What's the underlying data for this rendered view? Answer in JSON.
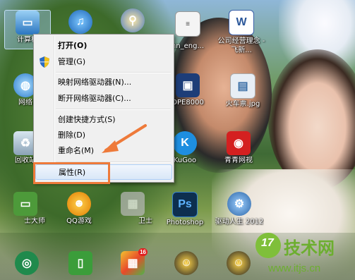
{
  "desktop_icons": [
    {
      "label": "计算机",
      "icon": "computer-icon",
      "selected": true
    },
    {
      "label": "",
      "icon": "itunes-icon"
    },
    {
      "label": "",
      "icon": "search-globe-icon"
    },
    {
      "label": "hn_eng...",
      "icon": "document-icon"
    },
    {
      "label": "公司经营理念 - 飞新...",
      "icon": "word-document-icon"
    },
    {
      "label": "网络",
      "icon": "network-icon"
    },
    {
      "label": "OPE8000",
      "icon": "application-icon"
    },
    {
      "label": "火车票.jpg",
      "icon": "image-file-icon"
    },
    {
      "label": "回收站",
      "icon": "recycle-bin-icon"
    },
    {
      "label": "KuGoo",
      "icon": "kugoo-icon"
    },
    {
      "label": "青青网视",
      "icon": "video-player-icon"
    },
    {
      "label": "士大师",
      "icon": "monitor-icon"
    },
    {
      "label": "QQ游戏",
      "icon": "qq-game-icon"
    },
    {
      "label": "卫士",
      "icon": "security-icon"
    },
    {
      "label": "Photoshop",
      "icon": "photoshop-icon"
    },
    {
      "label": "驱动人生 2012",
      "icon": "gear-icon"
    },
    {
      "label": "",
      "icon": "bank-icon"
    },
    {
      "label": "",
      "icon": "phone-icon"
    },
    {
      "label": "",
      "icon": "app-store-icon"
    },
    {
      "label": "",
      "icon": "qq-icon"
    },
    {
      "label": "",
      "icon": "qq-icon"
    }
  ],
  "app_badge": "16",
  "context_menu": {
    "items": [
      {
        "label": "打开(O)",
        "bold": true
      },
      {
        "label": "管理(G)",
        "shield": true
      },
      {
        "label": "映射网络驱动器(N)..."
      },
      {
        "label": "断开网络驱动器(C)..."
      },
      {
        "label": "创建快捷方式(S)"
      },
      {
        "label": "删除(D)"
      },
      {
        "label": "重命名(M)"
      },
      {
        "label": "属性(R)",
        "hovered": true
      }
    ]
  },
  "annotation": {
    "highlight_color": "#ee7a3a",
    "target": "属性(R)"
  },
  "watermark": {
    "brand": "技术网",
    "logo_text": "17",
    "url": "www.itjs.cn"
  }
}
